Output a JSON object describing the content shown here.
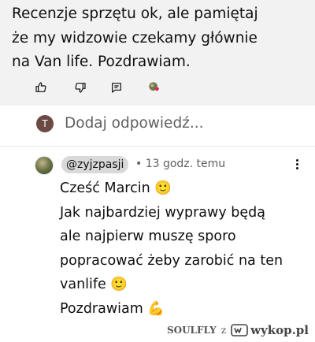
{
  "parent_comment": {
    "lines": [
      "Recenzje sprzętu ok, ale pamiętaj",
      "że my widzowie czekamy głównie",
      "na Van life. Pozdrawiam."
    ],
    "actions": [
      "like-icon",
      "dislike-icon",
      "reply-icon",
      "creator-heart-icon"
    ]
  },
  "reply_box": {
    "avatar_letter": "T",
    "placeholder": "Dodaj odpowiedź..."
  },
  "reply": {
    "handle": "@zyjzpasji",
    "time": "• 13 godz. temu",
    "lines": [
      "Cześć Marcin 🙂",
      "Jak najbardziej wyprawy będą",
      "ale najpierw muszę sporo",
      "popracować żeby zarobić na ten",
      "vanlife 🙂",
      "Pozdrawiam 💪"
    ]
  },
  "watermark": {
    "user": "SOULFLY",
    "z": "z",
    "site": "wykop.pl"
  },
  "colors": {
    "parent_bg": "#f2f2f2",
    "handle_bg": "#d9d9d9",
    "secondary_text": "#606060",
    "avatar_bg": "#6b4a44"
  }
}
